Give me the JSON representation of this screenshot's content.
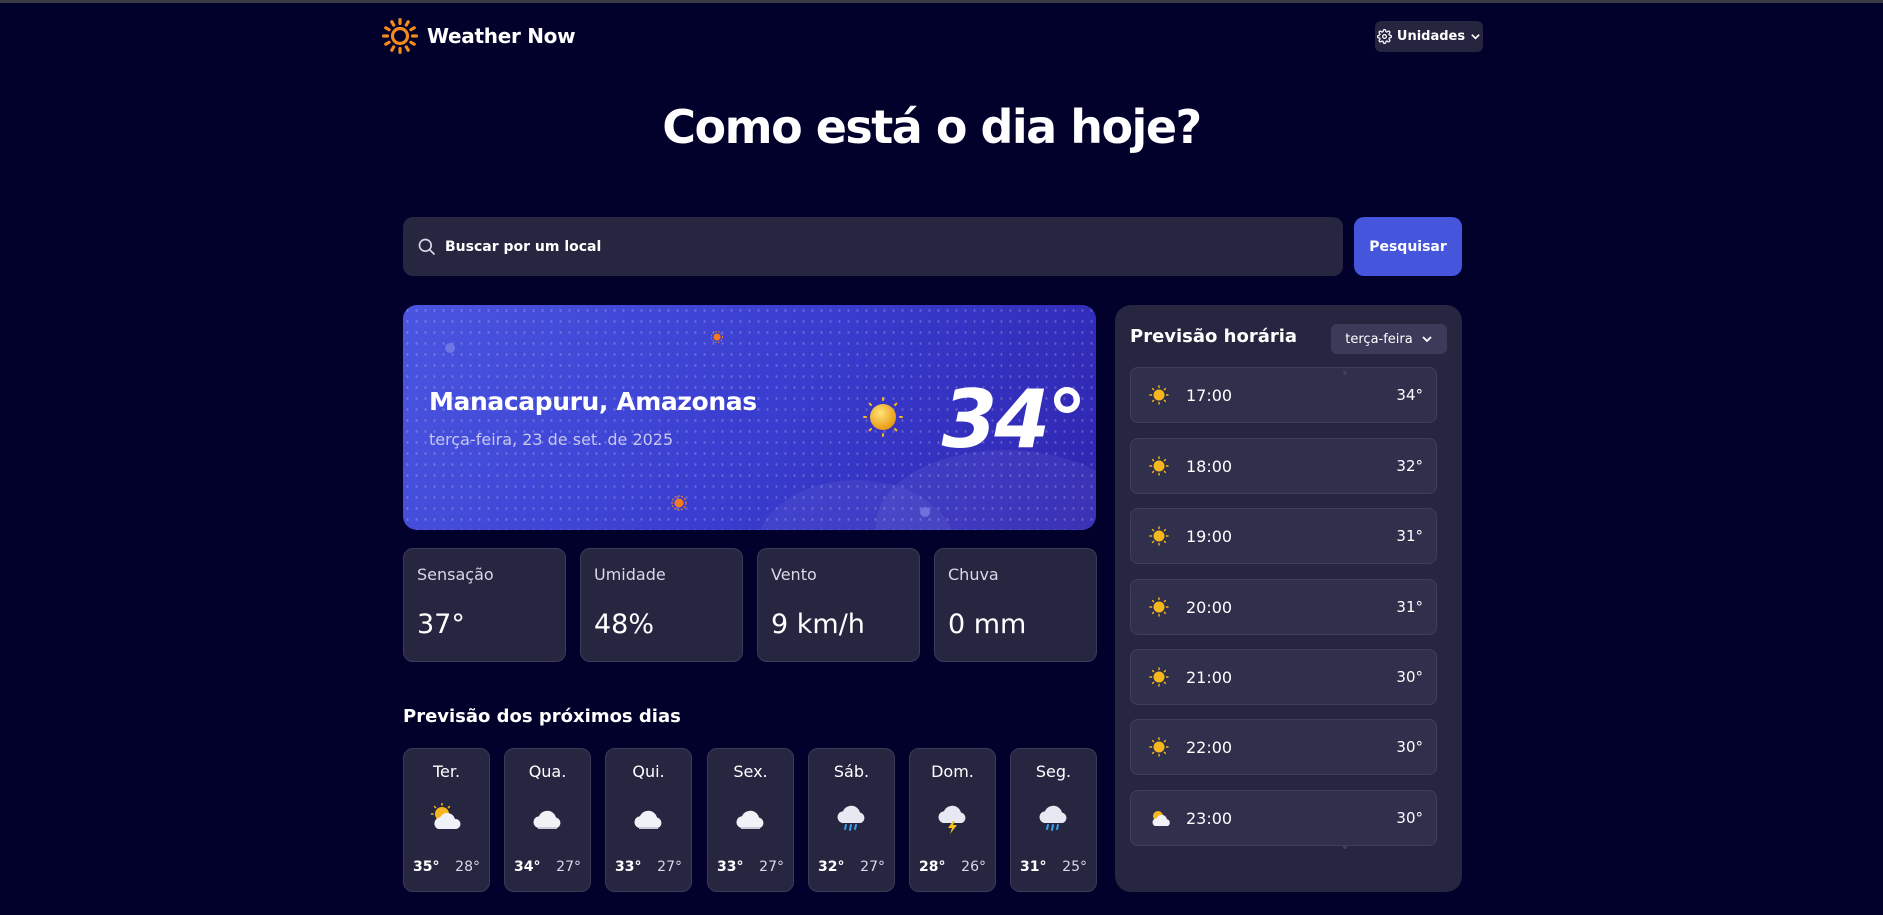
{
  "app": {
    "title": "Weather Now"
  },
  "header": {
    "units_label": "Unidades"
  },
  "hero": {
    "title": "Como está o dia hoje?"
  },
  "search": {
    "placeholder": "Buscar por um local",
    "button_label": "Pesquisar"
  },
  "current": {
    "location": "Manacapuru, Amazonas",
    "date": "terça-feira, 23 de set. de 2025",
    "temperature": "34°",
    "condition_icon": "sun-icon"
  },
  "stats": [
    {
      "label": "Sensação",
      "value": "37°"
    },
    {
      "label": "Umidade",
      "value": "48%"
    },
    {
      "label": "Vento",
      "value": "9 km/h"
    },
    {
      "label": "Chuva",
      "value": "0 mm"
    }
  ],
  "daily": {
    "title": "Previsão dos próximos dias",
    "days": [
      {
        "name": "Ter.",
        "icon": "partly-cloudy-icon",
        "max": "35°",
        "min": "28°"
      },
      {
        "name": "Qua.",
        "icon": "cloud-icon",
        "max": "34°",
        "min": "27°"
      },
      {
        "name": "Qui.",
        "icon": "cloud-icon",
        "max": "33°",
        "min": "27°"
      },
      {
        "name": "Sex.",
        "icon": "cloud-icon",
        "max": "33°",
        "min": "27°"
      },
      {
        "name": "Sáb.",
        "icon": "rain-cloud-icon",
        "max": "32°",
        "min": "27°"
      },
      {
        "name": "Dom.",
        "icon": "storm-cloud-icon",
        "max": "28°",
        "min": "26°"
      },
      {
        "name": "Seg.",
        "icon": "rain-cloud-icon",
        "max": "31°",
        "min": "25°"
      }
    ]
  },
  "hourly": {
    "title": "Previsão horária",
    "selected_day": "terça-feira",
    "hours": [
      {
        "time": "17:00",
        "temp": "34°",
        "icon": "sun-icon"
      },
      {
        "time": "18:00",
        "temp": "32°",
        "icon": "sun-icon"
      },
      {
        "time": "19:00",
        "temp": "31°",
        "icon": "sun-icon"
      },
      {
        "time": "20:00",
        "temp": "31°",
        "icon": "sun-icon"
      },
      {
        "time": "21:00",
        "temp": "30°",
        "icon": "sun-icon"
      },
      {
        "time": "22:00",
        "temp": "30°",
        "icon": "sun-icon"
      },
      {
        "time": "23:00",
        "temp": "30°",
        "icon": "partly-cloudy-icon"
      }
    ]
  },
  "colors": {
    "background": "#02012b",
    "panel": "#272641",
    "accent": "#4556dc",
    "logo": "#f28a1c",
    "sun": "#f5b81c"
  }
}
